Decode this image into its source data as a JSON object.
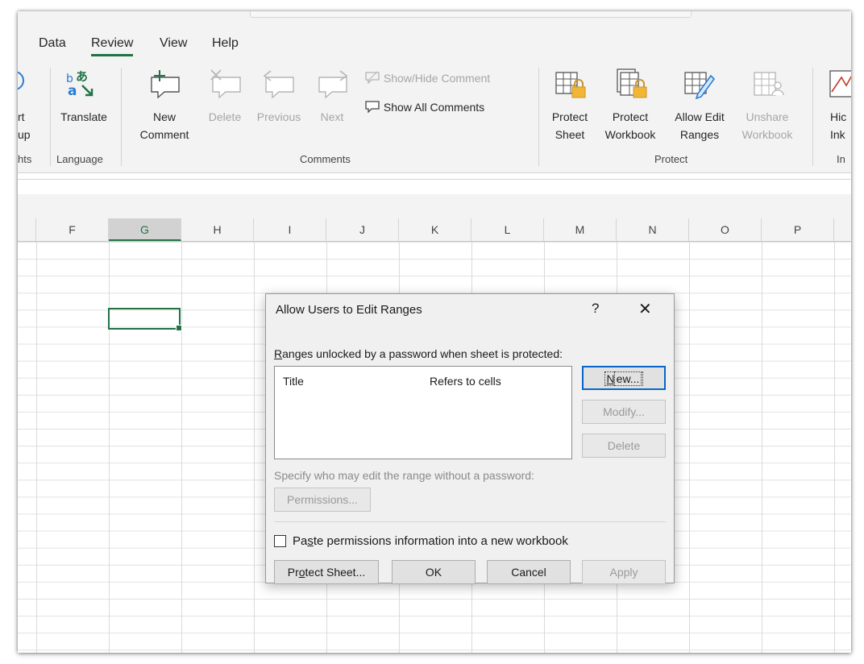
{
  "tabs": [
    {
      "label": "Data"
    },
    {
      "label": "Review"
    },
    {
      "label": "View"
    },
    {
      "label": "Help"
    }
  ],
  "ribbon": {
    "proofing": {
      "line1": "rt",
      "line2": "up",
      "group": "hts"
    },
    "language": {
      "translate": "Translate",
      "group": "Language"
    },
    "comments": {
      "new_line1": "New",
      "new_line2": "Comment",
      "delete": "Delete",
      "previous": "Previous",
      "next": "Next",
      "show_hide": "Show/Hide Comment",
      "show_all": "Show All Comments",
      "group": "Comments"
    },
    "protect": {
      "protect_sheet_1": "Protect",
      "protect_sheet_2": "Sheet",
      "protect_workbook_1": "Protect",
      "protect_workbook_2": "Workbook",
      "allow_edit_1": "Allow Edit",
      "allow_edit_2": "Ranges",
      "unshare_1": "Unshare",
      "unshare_2": "Workbook",
      "group": "Protect"
    },
    "ink": {
      "line1": "Hic",
      "line2": "Ink",
      "group": "In"
    }
  },
  "columns": [
    "F",
    "G",
    "H",
    "I",
    "J",
    "K",
    "L",
    "M",
    "N",
    "O",
    "P"
  ],
  "selected_column": "G",
  "dialog": {
    "title": "Allow Users to Edit Ranges",
    "help": "?",
    "close": "✕",
    "label_pre": "",
    "label_ul": "R",
    "label_post": "anges unlocked by a password when sheet is protected:",
    "list_headers": {
      "title": "Title",
      "refers": "Refers to cells"
    },
    "buttons": {
      "new_ul": "N",
      "new_rest": "ew...",
      "modify": "Modify...",
      "delete": "Delete",
      "permissions": "Permissions...",
      "protect_pre": "Pr",
      "protect_ul": "o",
      "protect_post": "tect Sheet...",
      "ok": "OK",
      "cancel": "Cancel",
      "apply": "Apply"
    },
    "specify": "Specify who may edit the range without a password:",
    "paste_pre": "Pa",
    "paste_ul": "s",
    "paste_post": "te permissions information into a new workbook",
    "paste_checked": false
  }
}
